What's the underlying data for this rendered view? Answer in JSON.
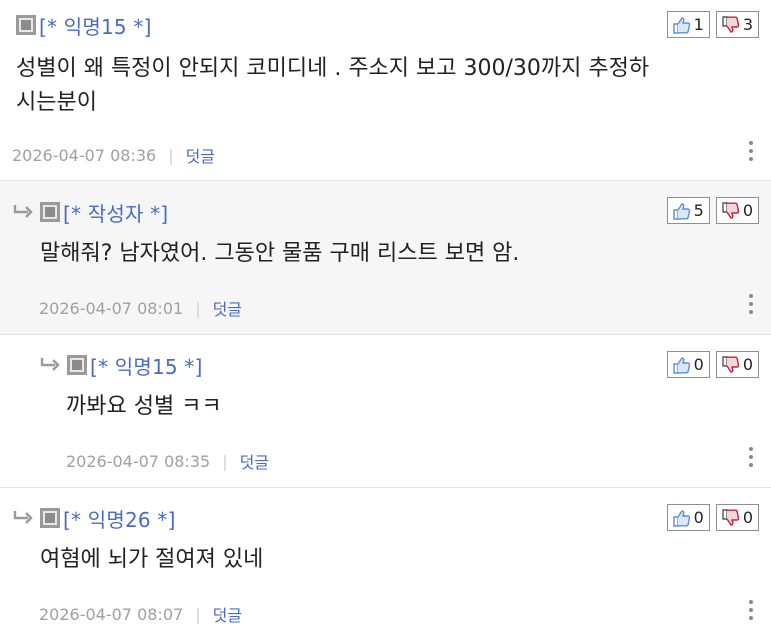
{
  "comments": [
    {
      "nickname": "[* 익명15 *]",
      "likes": "1",
      "dislikes": "3",
      "text": "성별이 왜 특정이 안되지 코미디네 . 주소지 보고 300/30까지 추정하\n시는분이",
      "date": "2026-04-07 08:36",
      "reply_label": "덧글"
    },
    {
      "nickname": "[* 작성자 *]",
      "likes": "5",
      "dislikes": "0",
      "text": "말해줘? 남자였어. 그동안 물품 구매 리스트 보면 암.",
      "date": "2026-04-07 08:01",
      "reply_label": "덧글"
    },
    {
      "nickname": "[* 익명15 *]",
      "likes": "0",
      "dislikes": "0",
      "text": "까봐요 성별 ㅋㅋ",
      "date": "2026-04-07 08:35",
      "reply_label": "덧글"
    },
    {
      "nickname": "[* 익명26 *]",
      "likes": "0",
      "dislikes": "0",
      "text": "여혐에 뇌가 절여져 있네",
      "date": "2026-04-07 08:07",
      "reply_label": "덧글"
    }
  ],
  "separator": "|",
  "icons": {
    "reply": "reply-arrow-icon",
    "avatar": "gray-square-icon",
    "like": "thumbs-up-icon",
    "dislike": "thumbs-down-icon",
    "more": "more-vertical-icon"
  },
  "colors": {
    "nickname": "#4b6bbd",
    "like_icon": "#5b8fd8",
    "dislike_icon": "#c0243c",
    "meta_text": "#a0a0a0",
    "alt_background": "#f6f6f6"
  }
}
